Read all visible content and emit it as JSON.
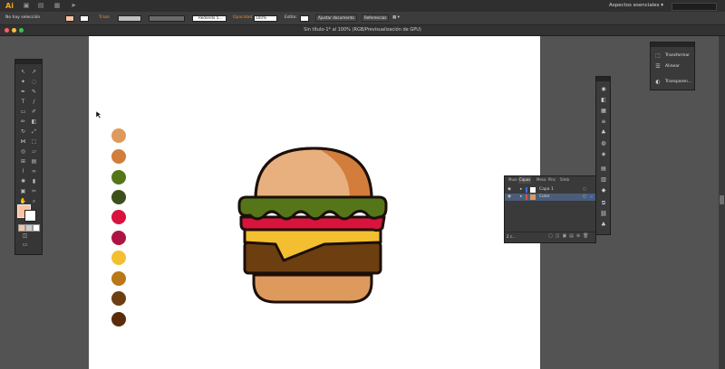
{
  "app": {
    "logo": "Ai",
    "workspace": "Aspectos esenciales ▾"
  },
  "control_bar": {
    "selection": "No hay selección",
    "stroke_label": "Trazo",
    "brush": "Redondo 5...",
    "opacity_label": "Opacidad",
    "opacity_value": "100%",
    "style_label": "Estilo:",
    "adjust_document": "Ajustar documento",
    "references": "Referencias",
    "fill_color": "#f9c2a2"
  },
  "document": {
    "title": "Sin título-1* al 100% (RGB/Previsualización de GPU)"
  },
  "swatches": [
    "#dd9a5c",
    "#d27d3c",
    "#547619",
    "#3d4f1b",
    "#d8133c",
    "#ad1444",
    "#f3be30",
    "#b97718",
    "#6c3e10",
    "#5a2c0a"
  ],
  "float_panel": {
    "items": [
      {
        "icon": "transform-icon",
        "label": "Transformar"
      },
      {
        "icon": "align-icon",
        "label": "Alinear"
      },
      {
        "icon": "transparency-icon",
        "label": "Transparen..."
      }
    ]
  },
  "layers_panel": {
    "tabs": [
      "Muer",
      "Capas",
      "Mesa",
      "Pinc",
      "Símb"
    ],
    "active_tab": "Capas",
    "layers": [
      {
        "name": "Capa 1",
        "color": "#3c6ee0",
        "selected": false
      },
      {
        "name": "Color",
        "color": "#e05050",
        "selected": true
      }
    ],
    "count": "2 c..."
  }
}
